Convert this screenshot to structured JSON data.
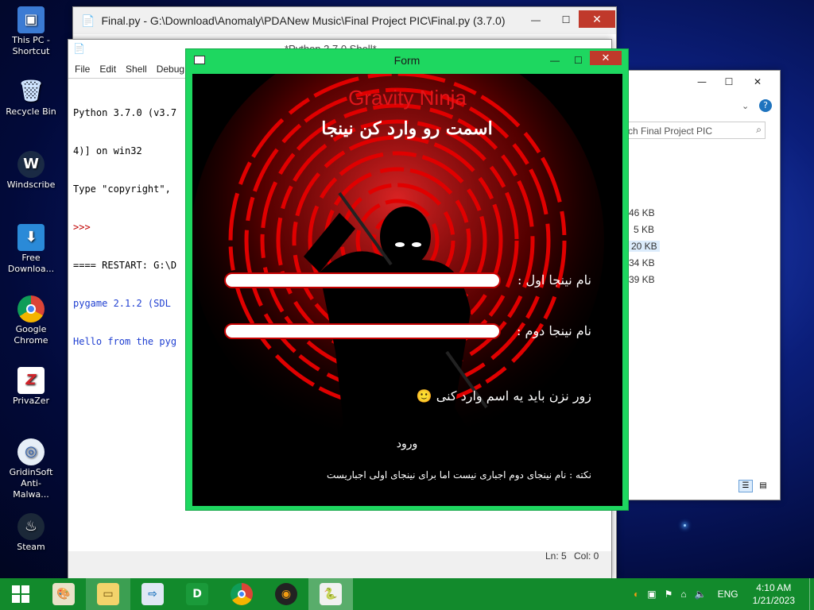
{
  "desktop": {
    "icons": [
      {
        "label": "This PC - Shortcut",
        "icon": "computer-icon"
      },
      {
        "label": "Recycle Bin",
        "icon": "recycle-bin-icon"
      },
      {
        "label": "Windscribe",
        "icon": "windscribe-icon"
      },
      {
        "label": "Free Downloa...",
        "icon": "download-icon"
      },
      {
        "label": "Google Chrome",
        "icon": "chrome-icon"
      },
      {
        "label": "PrivaZer",
        "icon": "privazer-icon"
      },
      {
        "label": "GridinSoft Anti-Malwa...",
        "icon": "antimalware-icon"
      },
      {
        "label": "Steam",
        "icon": "steam-icon"
      }
    ]
  },
  "editor_window": {
    "title": "Final.py - G:\\Download\\Anomaly\\PDANew Music\\Final Project PIC\\Final.py (3.7.0)"
  },
  "shell_window": {
    "title": "*Python 3.7.0 Shell*",
    "menu": [
      "File",
      "Edit",
      "Shell",
      "Debug"
    ],
    "lines": [
      {
        "text": "Python 3.7.0 (v3.7",
        "color": "#000000"
      },
      {
        "text": "4)] on win32",
        "color": "#000000"
      },
      {
        "text": "Type \"copyright\",",
        "color": "#000000"
      },
      {
        "text": ">>>",
        "color": "#c00000"
      },
      {
        "text": "==== RESTART: G:\\D",
        "color": "#000000"
      },
      {
        "text": "pygame 2.1.2 (SDL",
        "color": "#1f3fd1"
      },
      {
        "text": "Hello from the pyg",
        "color": "#1f3fd1"
      }
    ],
    "status": {
      "line": "Ln: 5",
      "col": "Col: 0"
    }
  },
  "explorer_window": {
    "search_placeholder": "ch Final Project PIC",
    "sizes": [
      "46 KB",
      "5 KB",
      "20 KB",
      "34 KB",
      "39 KB"
    ]
  },
  "form_window": {
    "title": "Form",
    "game_title": "Gravity Ninja",
    "subtitle": "اسمت رو وارد کن نینجا",
    "player1_label": "نام نینجا اول :",
    "player2_label": "نام نینجا دوم :",
    "player1_value": "",
    "player2_value": "",
    "warning": "زور نزن باید یه اسم وارد کنی 🙂",
    "enter_label": "ورود",
    "note": "نکته : نام نینجای دوم اجباری نیست اما برای نینجای اولی اجباریست",
    "colors": {
      "frame": "#1ed760",
      "title_red": "#e0161b",
      "ring_red": "#d10000"
    }
  },
  "taskbar": {
    "apps": [
      {
        "name": "paint-icon"
      },
      {
        "name": "file-explorer-icon"
      },
      {
        "name": "remote-desktop-icon"
      },
      {
        "name": "download-manager-icon"
      },
      {
        "name": "chrome-icon"
      },
      {
        "name": "media-player-icon"
      },
      {
        "name": "python-idle-icon"
      }
    ],
    "language": "ENG",
    "time": "4:10 AM",
    "date": "1/21/2023"
  }
}
